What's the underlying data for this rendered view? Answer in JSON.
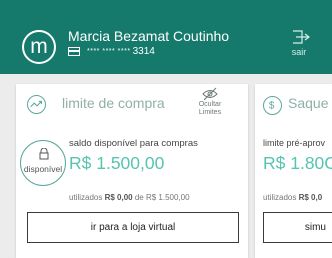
{
  "header": {
    "avatar_letter": "m",
    "user_name": "Marcia Bezamat Coutinho",
    "card_mask": "**** **** ****",
    "card_last_digits": "3314",
    "logout_label": "sair"
  },
  "limit_panel": {
    "title": "limite de compra",
    "hide_label": "Ocultar Limites",
    "available_badge": "disponível",
    "available_label": "saldo disponível para compras",
    "available_amount": "R$ 1.500,00",
    "used_prefix": "utilizados",
    "used_amount": "R$ 0,00",
    "used_connector": "de R$ 1.500,00",
    "button_label": "ir para a loja virtual"
  },
  "withdraw_panel": {
    "title": "Saque",
    "label": "limite pré-aprov",
    "amount": "R$ 1.80C",
    "used_prefix": "utilizados",
    "used_amount": "R$ 0,0",
    "button_label": "simu"
  },
  "colors": {
    "header_bg": "#157a6b",
    "accent": "#57c4b0",
    "panel_bg": "#ffffff",
    "page_bg": "#ececec"
  },
  "icons": [
    "avatar-circle",
    "card-icon",
    "logout-icon",
    "trend-icon",
    "eye-off-icon",
    "lock-icon",
    "dollar-icon"
  ]
}
